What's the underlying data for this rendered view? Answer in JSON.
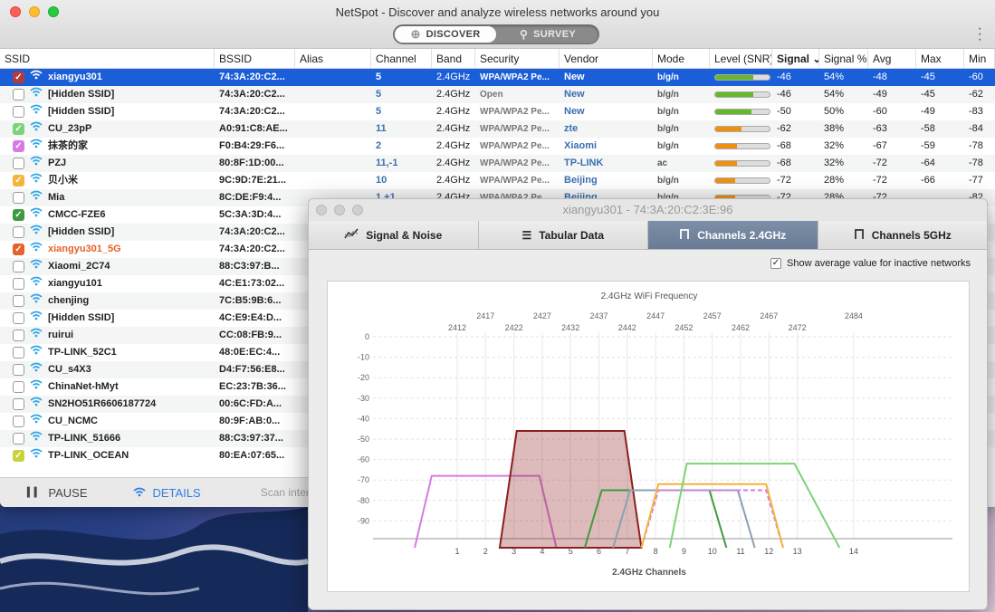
{
  "app": {
    "title": "NetSpot - Discover and analyze wireless networks around you",
    "mode_discover": "DISCOVER",
    "mode_survey": "SURVEY"
  },
  "columns": [
    "SSID",
    "BSSID",
    "Alias",
    "Channel",
    "Band",
    "Security",
    "Vendor",
    "Mode",
    "Level (SNR)",
    "Signal",
    "Signal %",
    "Avg",
    "Max",
    "Min"
  ],
  "networks": [
    {
      "ssid": "xiangyu301",
      "bssid": "74:3A:20:C2...",
      "alias": "",
      "channel": "5",
      "band": "2.4GHz",
      "security": "WPA/WPA2 Pe...",
      "vendor": "New",
      "mode": "b/g/n",
      "level": 0.7,
      "level_color": "#66b82a",
      "signal": "-46",
      "signal_pct": "54%",
      "avg": "-48",
      "max": "-45",
      "min": "-60",
      "checked": true,
      "check_color": "#b63a3a",
      "selected": true,
      "ssid_color": ""
    },
    {
      "ssid": "[Hidden SSID]",
      "bssid": "74:3A:20:C2...",
      "alias": "",
      "channel": "5",
      "band": "2.4GHz",
      "security": "Open",
      "vendor": "New",
      "mode": "b/g/n",
      "level": 0.7,
      "level_color": "#66b82a",
      "signal": "-46",
      "signal_pct": "54%",
      "avg": "-49",
      "max": "-45",
      "min": "-62",
      "checked": false,
      "check_color": "",
      "selected": false,
      "ssid_color": ""
    },
    {
      "ssid": "[Hidden SSID]",
      "bssid": "74:3A:20:C2...",
      "alias": "",
      "channel": "5",
      "band": "2.4GHz",
      "security": "WPA/WPA2 Pe...",
      "vendor": "New",
      "mode": "b/g/n",
      "level": 0.66,
      "level_color": "#66b82a",
      "signal": "-50",
      "signal_pct": "50%",
      "avg": "-60",
      "max": "-49",
      "min": "-83",
      "checked": false,
      "check_color": "",
      "selected": false,
      "ssid_color": ""
    },
    {
      "ssid": "CU_23pP",
      "bssid": "A0:91:C8:AE...",
      "alias": "",
      "channel": "11",
      "band": "2.4GHz",
      "security": "WPA/WPA2 Pe...",
      "vendor": "zte",
      "mode": "b/g/n",
      "level": 0.48,
      "level_color": "#f0900f",
      "signal": "-62",
      "signal_pct": "38%",
      "avg": "-63",
      "max": "-58",
      "min": "-84",
      "checked": true,
      "check_color": "#7cd37a",
      "selected": false,
      "ssid_color": ""
    },
    {
      "ssid": "抹茶的家",
      "bssid": "F0:B4:29:F6...",
      "alias": "",
      "channel": "2",
      "band": "2.4GHz",
      "security": "WPA/WPA2 Pe...",
      "vendor": "Xiaomi",
      "mode": "b/g/n",
      "level": 0.4,
      "level_color": "#f0900f",
      "signal": "-68",
      "signal_pct": "32%",
      "avg": "-67",
      "max": "-59",
      "min": "-78",
      "checked": true,
      "check_color": "#d67be3",
      "selected": false,
      "ssid_color": ""
    },
    {
      "ssid": "PZJ",
      "bssid": "80:8F:1D:00...",
      "alias": "",
      "channel": "11,-1",
      "band": "2.4GHz",
      "security": "WPA/WPA2 Pe...",
      "vendor": "TP-LINK",
      "mode": "ac",
      "level": 0.4,
      "level_color": "#f0900f",
      "signal": "-68",
      "signal_pct": "32%",
      "avg": "-72",
      "max": "-64",
      "min": "-78",
      "checked": false,
      "check_color": "",
      "selected": false,
      "ssid_color": ""
    },
    {
      "ssid": "贝小米",
      "bssid": "9C:9D:7E:21...",
      "alias": "",
      "channel": "10",
      "band": "2.4GHz",
      "security": "WPA/WPA2 Pe...",
      "vendor": "Beijing",
      "mode": "b/g/n",
      "level": 0.36,
      "level_color": "#f0900f",
      "signal": "-72",
      "signal_pct": "28%",
      "avg": "-72",
      "max": "-66",
      "min": "-77",
      "checked": true,
      "check_color": "#f3b43c",
      "selected": false,
      "ssid_color": ""
    },
    {
      "ssid": "Mia",
      "bssid": "8C:DE:F9:4...",
      "alias": "",
      "channel": "1,+1",
      "band": "2.4GHz",
      "security": "WPA/WPA2 Pe...",
      "vendor": "Beijing",
      "mode": "b/g/n",
      "level": 0.36,
      "level_color": "#f0900f",
      "signal": "-72",
      "signal_pct": "28%",
      "avg": "-72",
      "max": "",
      "min": "-82",
      "checked": false,
      "check_color": "",
      "selected": false,
      "ssid_color": ""
    },
    {
      "ssid": "CMCC-FZE6",
      "bssid": "5C:3A:3D:4...",
      "alias": "",
      "channel": "",
      "band": "",
      "security": "",
      "vendor": "",
      "mode": "",
      "level": 0,
      "level_color": "",
      "signal": "",
      "signal_pct": "",
      "avg": "",
      "max": "",
      "min": "",
      "checked": true,
      "check_color": "#3f9a3f",
      "selected": false,
      "ssid_color": ""
    },
    {
      "ssid": "[Hidden SSID]",
      "bssid": "74:3A:20:C2...",
      "alias": "",
      "channel": "",
      "band": "",
      "security": "",
      "vendor": "",
      "mode": "",
      "level": 0,
      "level_color": "",
      "signal": "",
      "signal_pct": "",
      "avg": "",
      "max": "",
      "min": "",
      "checked": false,
      "check_color": "",
      "selected": false,
      "ssid_color": ""
    },
    {
      "ssid": "xiangyu301_5G",
      "bssid": "74:3A:20:C2...",
      "alias": "",
      "channel": "",
      "band": "",
      "security": "",
      "vendor": "",
      "mode": "",
      "level": 0,
      "level_color": "",
      "signal": "",
      "signal_pct": "",
      "avg": "",
      "max": "",
      "min": "",
      "checked": true,
      "check_color": "#e6612b",
      "selected": false,
      "ssid_color": "#e6612b"
    },
    {
      "ssid": "Xiaomi_2C74",
      "bssid": "88:C3:97:B...",
      "alias": "",
      "channel": "",
      "band": "",
      "security": "",
      "vendor": "",
      "mode": "",
      "level": 0,
      "level_color": "",
      "signal": "",
      "signal_pct": "",
      "avg": "",
      "max": "",
      "min": "",
      "checked": false,
      "check_color": "",
      "selected": false,
      "ssid_color": ""
    },
    {
      "ssid": "xiangyu101",
      "bssid": "4C:E1:73:02...",
      "alias": "",
      "channel": "",
      "band": "",
      "security": "",
      "vendor": "",
      "mode": "",
      "level": 0,
      "level_color": "",
      "signal": "",
      "signal_pct": "",
      "avg": "",
      "max": "",
      "min": "",
      "checked": false,
      "check_color": "",
      "selected": false,
      "ssid_color": ""
    },
    {
      "ssid": "chenjing",
      "bssid": "7C:B5:9B:6...",
      "alias": "",
      "channel": "",
      "band": "",
      "security": "",
      "vendor": "",
      "mode": "",
      "level": 0,
      "level_color": "",
      "signal": "",
      "signal_pct": "",
      "avg": "",
      "max": "",
      "min": "",
      "checked": false,
      "check_color": "",
      "selected": false,
      "ssid_color": ""
    },
    {
      "ssid": "[Hidden SSID]",
      "bssid": "4C:E9:E4:D...",
      "alias": "",
      "channel": "",
      "band": "",
      "security": "",
      "vendor": "",
      "mode": "",
      "level": 0,
      "level_color": "",
      "signal": "",
      "signal_pct": "",
      "avg": "",
      "max": "",
      "min": "",
      "checked": false,
      "check_color": "",
      "selected": false,
      "ssid_color": ""
    },
    {
      "ssid": "ruirui",
      "bssid": "CC:08:FB:9...",
      "alias": "",
      "channel": "",
      "band": "",
      "security": "",
      "vendor": "",
      "mode": "",
      "level": 0,
      "level_color": "",
      "signal": "",
      "signal_pct": "",
      "avg": "",
      "max": "",
      "min": "",
      "checked": false,
      "check_color": "",
      "selected": false,
      "ssid_color": ""
    },
    {
      "ssid": "TP-LINK_52C1",
      "bssid": "48:0E:EC:4...",
      "alias": "",
      "channel": "",
      "band": "",
      "security": "",
      "vendor": "",
      "mode": "",
      "level": 0,
      "level_color": "",
      "signal": "",
      "signal_pct": "",
      "avg": "",
      "max": "",
      "min": "",
      "checked": false,
      "check_color": "",
      "selected": false,
      "ssid_color": ""
    },
    {
      "ssid": "CU_s4X3",
      "bssid": "D4:F7:56:E8...",
      "alias": "",
      "channel": "",
      "band": "",
      "security": "",
      "vendor": "",
      "mode": "",
      "level": 0,
      "level_color": "",
      "signal": "",
      "signal_pct": "",
      "avg": "",
      "max": "",
      "min": "",
      "checked": false,
      "check_color": "",
      "selected": false,
      "ssid_color": ""
    },
    {
      "ssid": "ChinaNet-hMyt",
      "bssid": "EC:23:7B:36...",
      "alias": "",
      "channel": "",
      "band": "",
      "security": "",
      "vendor": "",
      "mode": "",
      "level": 0,
      "level_color": "",
      "signal": "",
      "signal_pct": "",
      "avg": "",
      "max": "",
      "min": "",
      "checked": false,
      "check_color": "",
      "selected": false,
      "ssid_color": ""
    },
    {
      "ssid": "SN2HO51R6606187724",
      "bssid": "00:6C:FD:A...",
      "alias": "",
      "channel": "",
      "band": "",
      "security": "",
      "vendor": "",
      "mode": "",
      "level": 0,
      "level_color": "",
      "signal": "",
      "signal_pct": "",
      "avg": "",
      "max": "",
      "min": "",
      "checked": false,
      "check_color": "",
      "selected": false,
      "ssid_color": ""
    },
    {
      "ssid": "CU_NCMC",
      "bssid": "80:9F:AB:0...",
      "alias": "",
      "channel": "",
      "band": "",
      "security": "",
      "vendor": "",
      "mode": "",
      "level": 0,
      "level_color": "",
      "signal": "",
      "signal_pct": "",
      "avg": "",
      "max": "",
      "min": "",
      "checked": false,
      "check_color": "",
      "selected": false,
      "ssid_color": ""
    },
    {
      "ssid": "TP-LINK_51666",
      "bssid": "88:C3:97:37...",
      "alias": "",
      "channel": "",
      "band": "",
      "security": "",
      "vendor": "",
      "mode": "",
      "level": 0,
      "level_color": "",
      "signal": "",
      "signal_pct": "",
      "avg": "",
      "max": "",
      "min": "",
      "checked": false,
      "check_color": "",
      "selected": false,
      "ssid_color": ""
    },
    {
      "ssid": "TP-LINK_OCEAN",
      "bssid": "80:EA:07:65...",
      "alias": "",
      "channel": "",
      "band": "",
      "security": "",
      "vendor": "",
      "mode": "",
      "level": 0,
      "level_color": "",
      "signal": "",
      "signal_pct": "",
      "avg": "",
      "max": "",
      "min": "",
      "checked": true,
      "check_color": "#c8d33a",
      "selected": false,
      "ssid_color": ""
    }
  ],
  "bottom_bar": {
    "pause_label": "PAUSE",
    "details_label": "DETAILS",
    "scan_label": "Scan interva"
  },
  "detail": {
    "title": "xiangyu301 - 74:3A:20:C2:3E:96",
    "tabs": [
      "Signal & Noise",
      "Tabular Data",
      "Channels 2.4GHz",
      "Channels 5GHz"
    ],
    "active_tab": 2,
    "option_label": "Show average value for inactive networks",
    "option_checked": true
  },
  "chart_data": {
    "type": "area",
    "title": "2.4GHz WiFi Frequency",
    "xlabel": "2.4GHz Channels",
    "ylabel": "",
    "x_channels": [
      "1",
      "2",
      "3",
      "4",
      "5",
      "6",
      "7",
      "8",
      "9",
      "10",
      "11",
      "12",
      "13",
      "14"
    ],
    "freq_top_row": [
      "2417",
      "2427",
      "2437",
      "2447",
      "2457",
      "2467",
      "2484"
    ],
    "freq_bottom_row": [
      "2412",
      "2422",
      "2432",
      "2442",
      "2452",
      "2462",
      "2472"
    ],
    "y_ticks": [
      "0",
      "-10",
      "-20",
      "-30",
      "-40",
      "-50",
      "-60",
      "-70",
      "-80",
      "-90"
    ],
    "ylim": [
      -100,
      0
    ],
    "series": [
      {
        "channel": 2,
        "signal": -68,
        "color": "#d67be3",
        "filled": false,
        "dashed": false
      },
      {
        "channel": 5,
        "signal": -46,
        "color": "#8e1e1e",
        "filled": true,
        "dashed": false
      },
      {
        "channel": 8,
        "signal": -75,
        "color": "#3f9a3f",
        "filled": false,
        "dashed": false
      },
      {
        "channel": 9,
        "signal": -75,
        "color": "#8aa0b3",
        "filled": false,
        "dashed": false
      },
      {
        "channel": 10,
        "signal": -75,
        "color": "#d67be3",
        "filled": false,
        "dashed": true
      },
      {
        "channel": 10,
        "signal": -72,
        "color": "#f3b43c",
        "filled": false,
        "dashed": false
      },
      {
        "channel": 11,
        "signal": -62,
        "color": "#7cd37a",
        "filled": false,
        "dashed": false
      }
    ]
  }
}
